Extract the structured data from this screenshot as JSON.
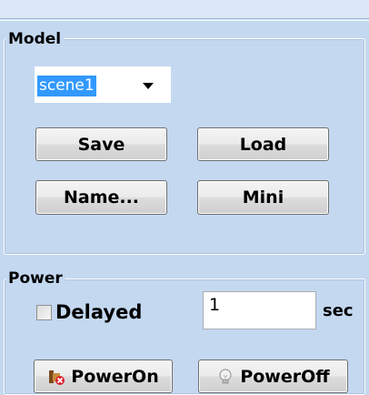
{
  "model": {
    "title": "Model",
    "scene_select": {
      "value": "scene1"
    },
    "buttons": {
      "save": "Save",
      "load": "Load",
      "name": "Name...",
      "mini": "Mini"
    }
  },
  "power": {
    "title": "Power",
    "delayed": {
      "label": "Delayed",
      "checked": false
    },
    "delay_value": "1",
    "delay_unit": "sec",
    "buttons": {
      "power_on": {
        "label": "PowerOn",
        "icon": "power-on-icon"
      },
      "power_off": {
        "label": "PowerOff",
        "icon": "bulb-off-icon"
      }
    }
  }
}
